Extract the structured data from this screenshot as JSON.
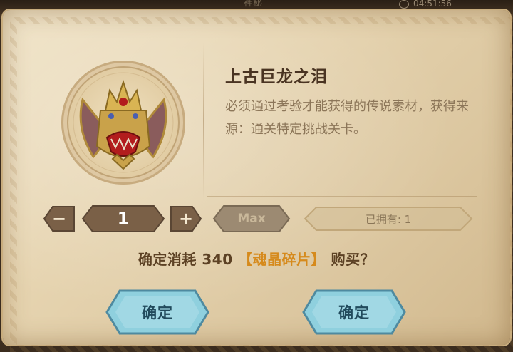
{
  "header": {
    "tab_label": "神秘",
    "timer": "04:51:56"
  },
  "item": {
    "name": "上古巨龙之泪",
    "description": "必须通过考验才能获得的传说素材，获得来源：通关特定挑战关卡。",
    "icon": "dragon-tear-emblem-icon"
  },
  "controls": {
    "minus_symbol": "−",
    "quantity": "1",
    "plus_symbol": "+",
    "max_label": "Max",
    "owned_label": "已拥有: 1"
  },
  "confirm": {
    "prefix": "确定消耗 340",
    "currency": "【魂晶碎片】",
    "suffix": " 购买？"
  },
  "buttons": {
    "left_confirm": "确定",
    "right_confirm": "确定"
  },
  "colors": {
    "parchment": "#e6d4b0",
    "button_teal": "#8fd0de",
    "highlight": "#d68a1c",
    "dark_wood": "#5a4634"
  }
}
